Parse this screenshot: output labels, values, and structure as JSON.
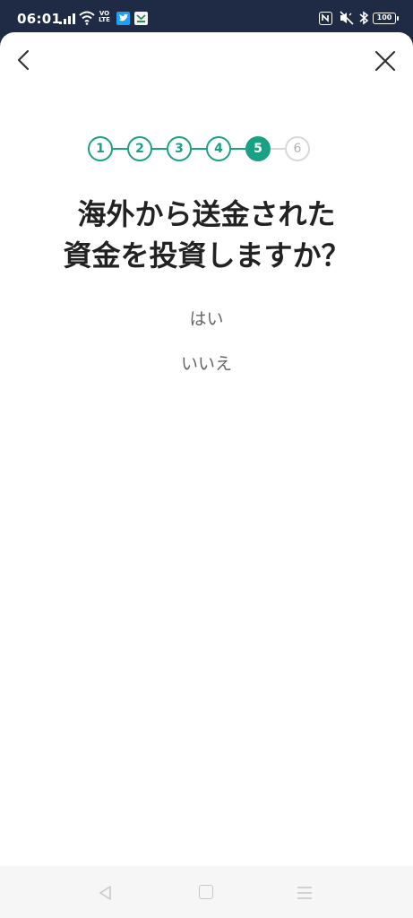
{
  "status_bar": {
    "time": "06:01",
    "volte": "VO LTE",
    "battery": "100",
    "icons": [
      "signal-icon",
      "wifi-icon",
      "volte-icon",
      "twitter-icon",
      "app-notification-icon",
      "nfc-icon",
      "mute-icon",
      "bluetooth-icon",
      "battery-icon"
    ]
  },
  "header": {
    "back_icon": "chevron-left-icon",
    "close_icon": "close-icon"
  },
  "stepper": {
    "steps": [
      "1",
      "2",
      "3",
      "4",
      "5",
      "6"
    ],
    "current": 5,
    "color_done": "#1aa082",
    "color_upcoming": "#d8d8d8"
  },
  "question": {
    "line1": "海外から送金された",
    "line2": "資金を投資しますか？"
  },
  "options": {
    "yes": "はい",
    "no": "いいえ"
  },
  "nav_bar": {
    "icons": [
      "nav-back-icon",
      "nav-home-icon",
      "nav-menu-icon"
    ]
  }
}
